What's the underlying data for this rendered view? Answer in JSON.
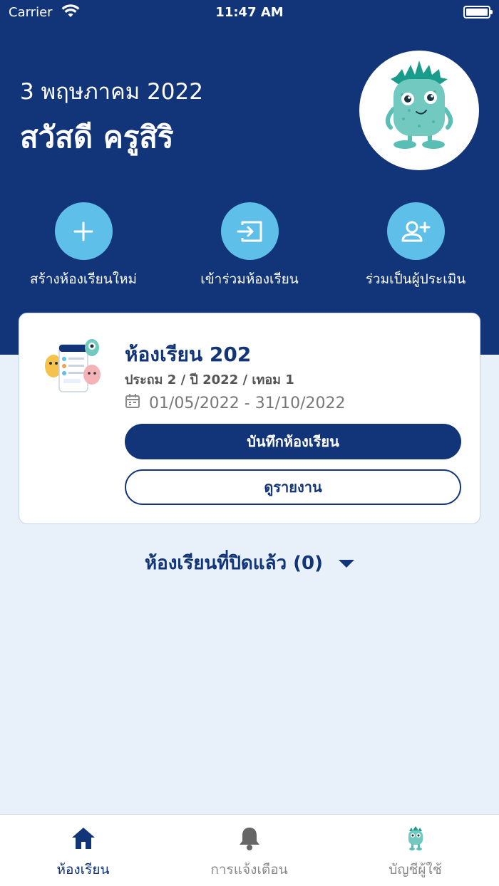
{
  "status_bar": {
    "carrier": "Carrier",
    "time": "11:47 AM"
  },
  "header": {
    "date": "3 พฤษภาคม 2022",
    "greeting": "สวัสดี ครูสิริ"
  },
  "actions": [
    {
      "label": "สร้างห้องเรียนใหม่",
      "icon": "plus-icon"
    },
    {
      "label": "เข้าร่วมห้องเรียน",
      "icon": "join-icon"
    },
    {
      "label": "ร่วมเป็นผู้ประเมิน",
      "icon": "add-person-icon"
    }
  ],
  "classroom": {
    "name": "ห้องเรียน 202",
    "meta": "ประถม 2 / ปี 2022 / เทอม 1",
    "dates": "01/05/2022 - 31/10/2022",
    "record_label": "บันทึกห้องเรียน",
    "report_label": "ดูรายงาน"
  },
  "closed": {
    "label": "ห้องเรียนที่ปิดแล้ว (0)"
  },
  "tabs": [
    {
      "label": "ห้องเรียน",
      "icon": "home-icon",
      "active": true
    },
    {
      "label": "การแจ้งเตือน",
      "icon": "bell-icon",
      "active": false
    },
    {
      "label": "บัญชีผู้ใช้",
      "icon": "monster-icon",
      "active": false
    }
  ],
  "colors": {
    "primary": "#123479",
    "accent": "#5ec0e9",
    "background": "#e8f0fa"
  }
}
